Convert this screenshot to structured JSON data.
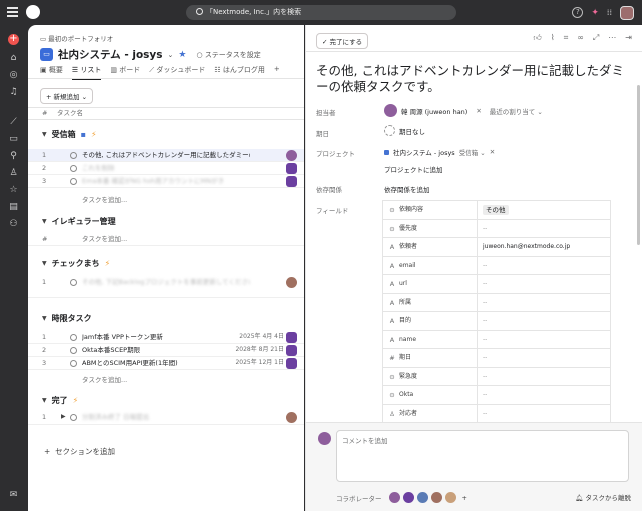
{
  "topbar": {
    "search_placeholder": "「Nextmode, Inc.」内を検索",
    "help": "?"
  },
  "project": {
    "breadcrumb": "最初のポートフォリオ",
    "name": "社内システム - josys",
    "set_status": "ステータスを設定",
    "tabs": [
      "概要",
      "リスト",
      "ボード",
      "ダッシュボード",
      "はんブログ用"
    ],
    "active_tab": "リスト",
    "add_button": "新規追加",
    "col_task": "タスク名",
    "col_hash": "#",
    "add_task": "タスクを追加...",
    "add_section": "セクションを追加",
    "sections": [
      {
        "name": "受信箱",
        "tasks": [
          {
            "n": "1",
            "title": "その他, これはアドベントカレンダー用に記載したダミーの依",
            "blurred": false,
            "date": ""
          },
          {
            "n": "2",
            "title": "これを削除",
            "blurred": true,
            "date": ""
          },
          {
            "n": "3",
            "title": "Ema本番 確認がNG hoh用アカウントにMNがき",
            "blurred": true,
            "date": ""
          }
        ]
      },
      {
        "name": "イレギュラー管理",
        "tasks": []
      },
      {
        "name": "チェックまち",
        "tasks": [
          {
            "n": "1",
            "title": "その他, 下記Backlogプロジェクトを事前更新してください",
            "blurred": true,
            "date": ""
          }
        ]
      },
      {
        "name": "時限タスク",
        "tasks": [
          {
            "n": "1",
            "title": "Jamf本番 VPPトークン更新",
            "blurred": false,
            "date": "2025年 4月 4日"
          },
          {
            "n": "2",
            "title": "Okta本番SCEP期限",
            "blurred": false,
            "date": "2028年 8月 21日"
          },
          {
            "n": "3",
            "title": "ABMとのSCIM用API更新(1年間)",
            "blurred": false,
            "date": "2025年 12月 1日"
          }
        ]
      },
      {
        "name": "完了",
        "tasks": [
          {
            "n": "1",
            "title": "分割済み終了 日報提出",
            "blurred": true,
            "date": ""
          }
        ]
      }
    ]
  },
  "detail": {
    "complete_button": "完了にする",
    "title": "その他, これはアドベントカレンダー用に記載したダミーの依頼タスクです。",
    "assignee_label": "担当者",
    "assignee": "韓 周源 (juweon han)",
    "recent_assign": "最近の割り当て",
    "due_label": "期日",
    "due_value": "期日なし",
    "project_label": "プロジェクト",
    "project_value": "社内システム - josys",
    "project_section": "受信箱",
    "add_project": "プロジェクトに追加",
    "deps_label": "依存関係",
    "deps_value": "依存関係を追加",
    "fields_label": "フィールド",
    "fields": [
      {
        "icon": "⊙",
        "name": "依頼内容",
        "value": "その他",
        "tag": true
      },
      {
        "icon": "⊙",
        "name": "優先度",
        "value": "--",
        "tag": false
      },
      {
        "icon": "A",
        "name": "依頼者",
        "value": "juweon.han@nextmode.co.jp",
        "tag": false
      },
      {
        "icon": "A",
        "name": "email",
        "value": "--",
        "tag": false
      },
      {
        "icon": "A",
        "name": "url",
        "value": "--",
        "tag": false
      },
      {
        "icon": "A",
        "name": "所属",
        "value": "--",
        "tag": false
      },
      {
        "icon": "A",
        "name": "目的",
        "value": "--",
        "tag": false
      },
      {
        "icon": "A",
        "name": "name",
        "value": "--",
        "tag": false
      },
      {
        "icon": "#",
        "name": "期日",
        "value": "--",
        "tag": false
      },
      {
        "icon": "⊙",
        "name": "緊急度",
        "value": "--",
        "tag": false
      },
      {
        "icon": "⊙",
        "name": "Okta",
        "value": "--",
        "tag": false
      },
      {
        "icon": "♙",
        "name": "対応者",
        "value": "--",
        "tag": false
      }
    ],
    "comment_placeholder": "コメントを追加",
    "collaborators_label": "コラボレーター",
    "leave_task": "タスクから離脱"
  }
}
